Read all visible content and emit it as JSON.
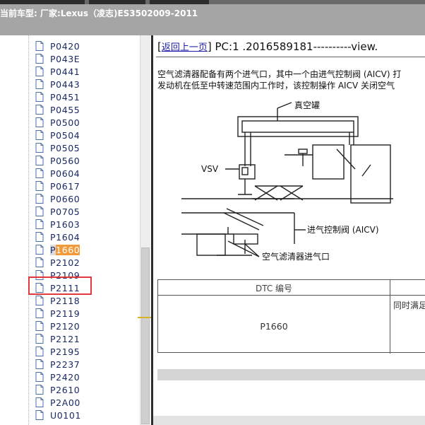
{
  "header": {
    "title": "当前车型:  厂家:Lexus（凌志)ES3502009-2011"
  },
  "tree": {
    "items": [
      {
        "label": "P0420"
      },
      {
        "label": "P043E"
      },
      {
        "label": "P0441"
      },
      {
        "label": "P0443"
      },
      {
        "label": "P0451"
      },
      {
        "label": "P0455"
      },
      {
        "label": "P0500"
      },
      {
        "label": "P0504"
      },
      {
        "label": "P0505"
      },
      {
        "label": "P0560"
      },
      {
        "label": "P0604"
      },
      {
        "label": "P0617"
      },
      {
        "label": "P0660"
      },
      {
        "label": "P0705"
      },
      {
        "label": "P1603"
      },
      {
        "label": "P1604"
      },
      {
        "label": "P1660",
        "selected": true
      },
      {
        "label": "P2102"
      },
      {
        "label": "P2109"
      },
      {
        "label": "P2111"
      },
      {
        "label": "P2118"
      },
      {
        "label": "P2119"
      },
      {
        "label": "P2120"
      },
      {
        "label": "P2121"
      },
      {
        "label": "P2195"
      },
      {
        "label": "P2237"
      },
      {
        "label": "P2420"
      },
      {
        "label": "P2610"
      },
      {
        "label": "P2A00"
      },
      {
        "label": "U0101"
      }
    ],
    "selected_prefix": "P",
    "selected_highlight": "1660"
  },
  "content": {
    "back_link": "返回上一页",
    "nav_text": "PC:1 .2016589181----------view.",
    "desc_line1": "空气滤清器配备有两个进气口，其中一个由进气控制阀 (AICV) 打",
    "desc_line2": "发动机在低至中转速范围内工作时，该控制操作 AICV 关闭空气",
    "diagram": {
      "label_vacuum": "真空罐",
      "label_vsv": "VSV",
      "label_aicv": "进气控制阀 (AICV)",
      "label_inlet": "空气滤清器进气口"
    },
    "table": {
      "header_dtc": "DTC 编号",
      "code": "P1660",
      "condition": "同时满足"
    }
  },
  "colors": {
    "header_bg": "#a5a5a5",
    "selection_box": "#e0393b",
    "highlight": "#f29b3a",
    "link": "#1a1aa8"
  }
}
